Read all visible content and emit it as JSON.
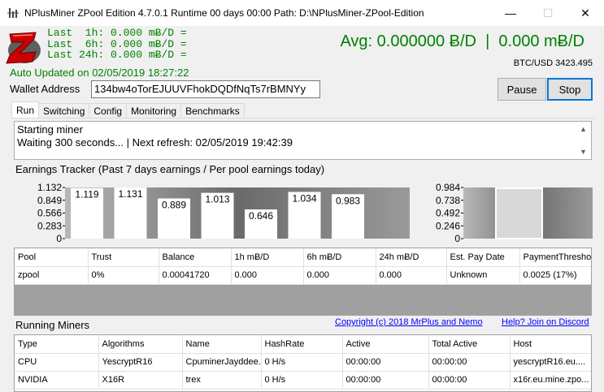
{
  "window": {
    "title": "NPlusMiner ZPool Edition 4.7.0.1 Runtime 00 days 00:00 Path: D:\\NPlusMiner-ZPool-Edition",
    "minimize": "—",
    "maximize": "☐",
    "close": "✕"
  },
  "header": {
    "last_1h": "Last  1h: 0.000 mɃ/D =",
    "last_6h": "Last  6h: 0.000 mɃ/D =",
    "last_24h": "Last 24h: 0.000 mɃ/D =",
    "auto_updated": "Auto Updated on 02/05/2019 18:27:22",
    "avg": "Avg: 0.000000 Ƀ/D  |  0.000 mɃ/D",
    "btc_usd": "BTC/USD 3423.495"
  },
  "wallet": {
    "label": "Wallet Address",
    "value": "134bw4oTorEJUUVFhokDQDfNqTs7rBMNYy"
  },
  "buttons": {
    "pause": "Pause",
    "stop": "Stop"
  },
  "tabs": [
    {
      "label": "Run",
      "active": true
    },
    {
      "label": "Switching",
      "active": false
    },
    {
      "label": "Config",
      "active": false
    },
    {
      "label": "Monitoring",
      "active": false
    },
    {
      "label": "Benchmarks",
      "active": false
    }
  ],
  "log": {
    "line1": "Starting miner",
    "line2": "Waiting 300 seconds... | Next refresh: 02/05/2019 19:42:39"
  },
  "earnings_label": "Earnings Tracker (Past 7 days earnings / Per pool earnings today)",
  "chart_data": [
    {
      "type": "bar",
      "categories": [
        "",
        "",
        "",
        "",
        "",
        "",
        ""
      ],
      "values": [
        1.119,
        1.131,
        0.889,
        1.013,
        0.646,
        1.034,
        0.983
      ],
      "ylim": [
        0,
        1.132
      ],
      "yticks": [
        "1.132",
        "0.849",
        "0.566",
        "0.283",
        "0"
      ],
      "data_labels": [
        "1.119",
        "1.131",
        "0.889",
        "1.013",
        "0.646",
        "1.034",
        "0.983"
      ]
    },
    {
      "type": "bar",
      "categories": [
        ""
      ],
      "values": [
        0.97
      ],
      "ylim": [
        0,
        0.984
      ],
      "yticks": [
        "0.984",
        "0.738",
        "0.492",
        "0.246",
        "0"
      ]
    }
  ],
  "pool_table": {
    "headers": [
      "Pool",
      "Trust",
      "Balance",
      "1h mɃ/D",
      "6h mɃ/D",
      "24h mɃ/D",
      "Est. Pay Date",
      "PaymentThresho"
    ],
    "rows": [
      [
        "zpool",
        "0%",
        "0.00041720",
        "0.000",
        "0.000",
        "0.000",
        "Unknown",
        "0.0025 (17%)"
      ]
    ]
  },
  "running_miners_label": "Running Miners",
  "links": {
    "copyright": "Copyright (c) 2018 MrPlus and Nemo",
    "discord": "Help? Join on Discord"
  },
  "miners_table": {
    "headers": [
      "Type",
      "Algorithms",
      "Name",
      "HashRate",
      "Active",
      "Total Active",
      "Host"
    ],
    "rows": [
      [
        "CPU",
        "YescryptR16",
        "CpuminerJayddee...",
        "0  H/s",
        "00:00:00",
        "00:00:00",
        "yescryptR16.eu...."
      ],
      [
        "NVIDIA",
        "X16R",
        "trex",
        "0  H/s",
        "00:00:00",
        "00:00:00",
        "x16r.eu.mine.zpo..."
      ]
    ]
  }
}
